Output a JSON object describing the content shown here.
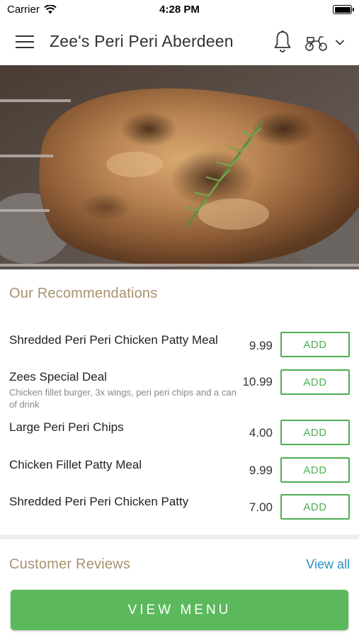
{
  "status_bar": {
    "carrier": "Carrier",
    "time": "4:28 PM"
  },
  "header": {
    "title": "Zee's Peri Peri Aberdeen",
    "icons": [
      "menu-icon",
      "bell-icon",
      "scooter-icon",
      "chevron-down-icon"
    ]
  },
  "hero": {
    "icon": "grilled-chicken-image"
  },
  "recommendations": {
    "title": "Our Recommendations",
    "add_label": "ADD",
    "items": [
      {
        "name": "Shredded Peri Peri Chicken Patty Meal",
        "description": "",
        "price": "9.99"
      },
      {
        "name": "Zees Special Deal",
        "description": "Chicken fillet burger, 3x wings, peri peri chips and a can of drink",
        "price": "10.99"
      },
      {
        "name": "Large Peri Peri Chips",
        "description": "",
        "price": "4.00"
      },
      {
        "name": "Chicken Fillet Patty Meal",
        "description": "",
        "price": "9.99"
      },
      {
        "name": "Shredded Peri Peri Chicken Patty",
        "description": "",
        "price": "7.00"
      }
    ]
  },
  "reviews": {
    "title": "Customer Reviews",
    "view_all": "View all"
  },
  "cta": {
    "label": "VIEW MENU"
  },
  "colors": {
    "accent_green": "#5cb85c",
    "section_title": "#a8916f",
    "link_blue": "#2a8fc7"
  }
}
